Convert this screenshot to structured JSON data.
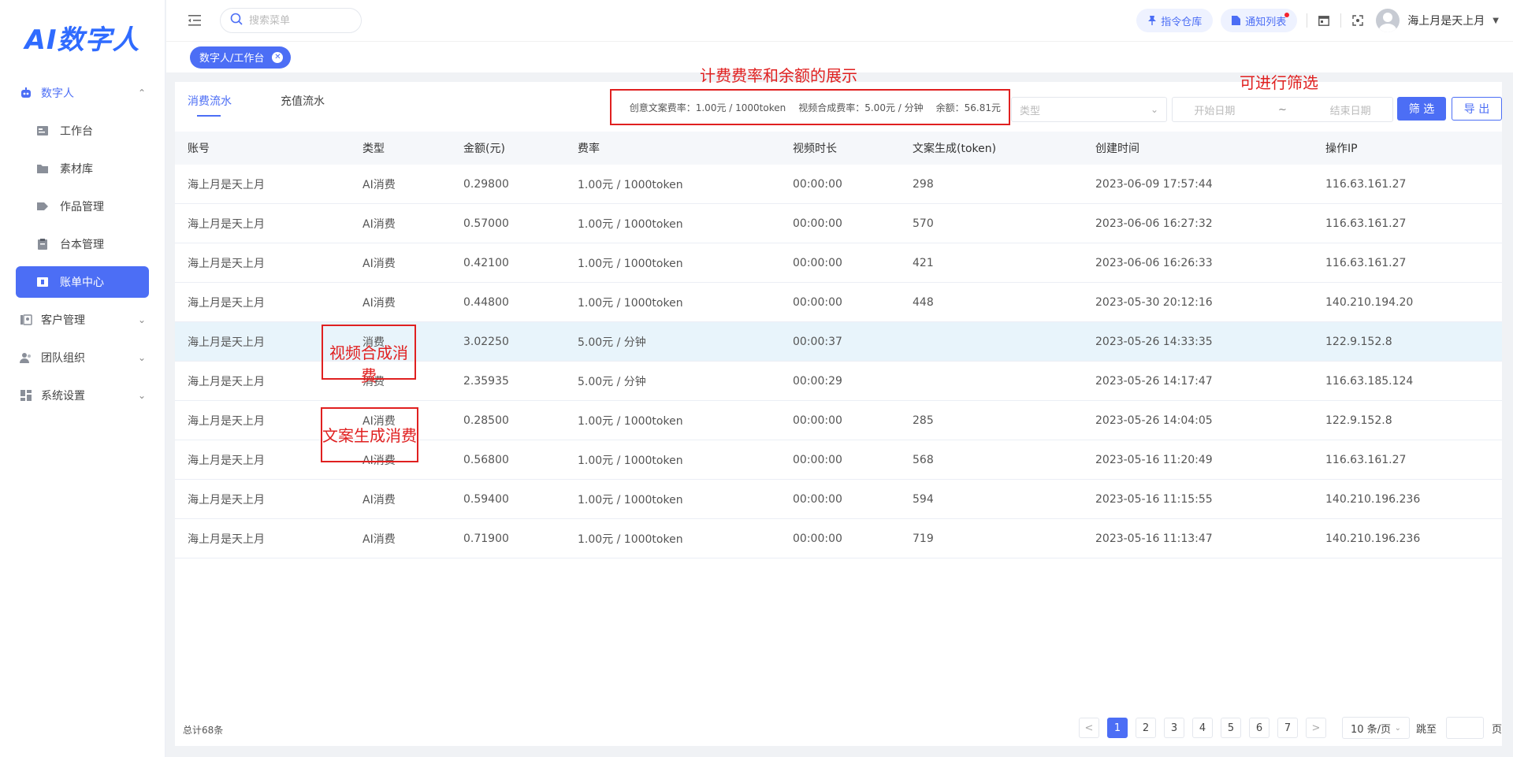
{
  "app": {
    "logo": "AI数字人"
  },
  "sidebar": {
    "groups": [
      {
        "label": "数字人",
        "icon": "robot-icon"
      },
      {
        "label": "客户管理",
        "icon": "contacts-icon"
      },
      {
        "label": "团队组织",
        "icon": "team-icon"
      },
      {
        "label": "系统设置",
        "icon": "settings-icon"
      }
    ],
    "sub_items": [
      {
        "label": "工作台",
        "icon": "workbench-icon"
      },
      {
        "label": "素材库",
        "icon": "folder-icon"
      },
      {
        "label": "作品管理",
        "icon": "tag-icon"
      },
      {
        "label": "台本管理",
        "icon": "clipboard-icon"
      },
      {
        "label": "账单中心",
        "icon": "bill-icon"
      }
    ]
  },
  "header": {
    "search_placeholder": "搜索菜单",
    "btn_command": "指令仓库",
    "btn_notice": "通知列表",
    "username": "海上月是天上月"
  },
  "tagbar": {
    "tag": "数字人/工作台"
  },
  "tabs": [
    "消费流水",
    "充值流水"
  ],
  "rates": {
    "text_rate": "创意文案费率：1.00元 / 1000token",
    "video_rate": "视频合成费率：5.00元 / 分钟",
    "balance": "余额：56.81元"
  },
  "annotations": {
    "rate": "计费费率和余额的展示",
    "filter": "可进行筛选",
    "video": "视频合成消费",
    "text": "文案生成消费"
  },
  "filters": {
    "type_placeholder": "类型",
    "start_date": "开始日期",
    "tilde": "~",
    "end_date": "结束日期",
    "btn_filter": "筛 选",
    "btn_export": "导 出"
  },
  "table": {
    "headers": [
      "账号",
      "类型",
      "金额(元)",
      "费率",
      "视频时长",
      "文案生成(token)",
      "创建时间",
      "操作IP"
    ],
    "rows": [
      [
        "海上月是天上月",
        "AI消费",
        "0.29800",
        "1.00元 / 1000token",
        "00:00:00",
        "298",
        "2023-06-09 17:57:44",
        "116.63.161.27"
      ],
      [
        "海上月是天上月",
        "AI消费",
        "0.57000",
        "1.00元 / 1000token",
        "00:00:00",
        "570",
        "2023-06-06 16:27:32",
        "116.63.161.27"
      ],
      [
        "海上月是天上月",
        "AI消费",
        "0.42100",
        "1.00元 / 1000token",
        "00:00:00",
        "421",
        "2023-06-06 16:26:33",
        "116.63.161.27"
      ],
      [
        "海上月是天上月",
        "AI消费",
        "0.44800",
        "1.00元 / 1000token",
        "00:00:00",
        "448",
        "2023-05-30 20:12:16",
        "140.210.194.20"
      ],
      [
        "海上月是天上月",
        "消费",
        "3.02250",
        "5.00元 / 分钟",
        "00:00:37",
        "",
        "2023-05-26 14:33:35",
        "122.9.152.8"
      ],
      [
        "海上月是天上月",
        "消费",
        "2.35935",
        "5.00元 / 分钟",
        "00:00:29",
        "",
        "2023-05-26 14:17:47",
        "116.63.185.124"
      ],
      [
        "海上月是天上月",
        "AI消费",
        "0.28500",
        "1.00元 / 1000token",
        "00:00:00",
        "285",
        "2023-05-26 14:04:05",
        "122.9.152.8"
      ],
      [
        "海上月是天上月",
        "AI消费",
        "0.56800",
        "1.00元 / 1000token",
        "00:00:00",
        "568",
        "2023-05-16 11:20:49",
        "116.63.161.27"
      ],
      [
        "海上月是天上月",
        "AI消费",
        "0.59400",
        "1.00元 / 1000token",
        "00:00:00",
        "594",
        "2023-05-16 11:15:55",
        "140.210.196.236"
      ],
      [
        "海上月是天上月",
        "AI消费",
        "0.71900",
        "1.00元 / 1000token",
        "00:00:00",
        "719",
        "2023-05-16 11:13:47",
        "140.210.196.236"
      ]
    ]
  },
  "footer": {
    "total": "总计68条",
    "prev": "<",
    "pages": [
      "1",
      "2",
      "3",
      "4",
      "5",
      "6",
      "7"
    ],
    "next": ">",
    "page_size": "10 条/页",
    "jump_label": "跳至",
    "page_suffix": "页"
  }
}
